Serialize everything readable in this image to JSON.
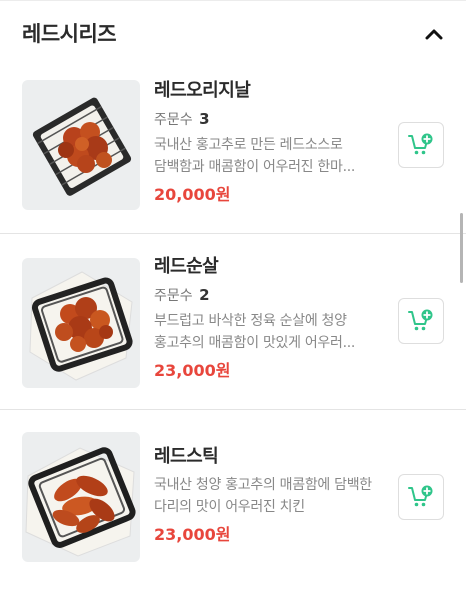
{
  "section": {
    "title": "레드시리즈",
    "collapse_icon": "chevron-up-icon"
  },
  "order_count_label": "주문수",
  "items": [
    {
      "name": "레드오리지날",
      "order_count": "3",
      "description": "국내산 홍고추로 만든 레드소스로 담백함과 매콤함이 어우러진 한마...",
      "price": "20,000원",
      "cart_icon": "add-to-cart-icon"
    },
    {
      "name": "레드순살",
      "order_count": "2",
      "description": "부드럽고 바삭한 정육 순살에 청양 홍고추의 매콤함이 맛있게 어우러...",
      "price": "23,000원",
      "cart_icon": "add-to-cart-icon"
    },
    {
      "name": "레드스틱",
      "order_count": "",
      "description": "국내산 청양 홍고추의 매콤함에 담백한 다리의 맛이 어우러진 치킨",
      "price": "23,000원",
      "cart_icon": "add-to-cart-icon"
    }
  ],
  "colors": {
    "price": "#e8463c",
    "cart_accent": "#2fc58a",
    "divider": "#e4e4e4"
  }
}
